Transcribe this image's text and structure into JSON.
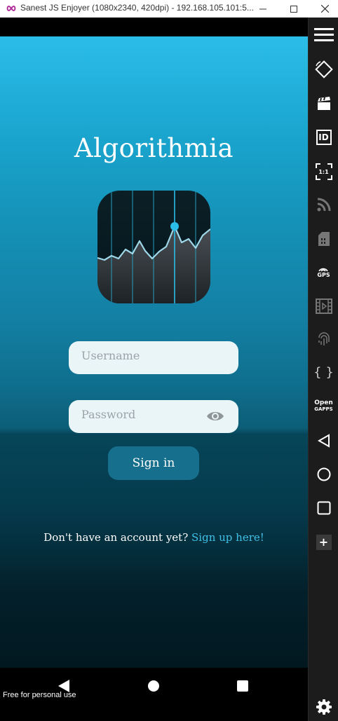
{
  "window": {
    "title": "Sanest JS Enjoyer (1080x2340, 420dpi) - 192.168.105.101:5...",
    "minimize_glyph": "—",
    "maximize_glyph": "☐",
    "close_glyph": "✕"
  },
  "app": {
    "title": "Algorithmia",
    "username_placeholder": "Username",
    "password_placeholder": "Password",
    "sign_in_label": "Sign in",
    "signup_prompt": "Don't have an account yet? ",
    "signup_link": "Sign up here!"
  },
  "navbar": {
    "watermark": "Free for personal use"
  },
  "sidebar": {
    "items": [
      {
        "icon": "menu-icon"
      },
      {
        "icon": "rotate-icon"
      },
      {
        "icon": "clapperboard-icon"
      },
      {
        "icon": "id-icon",
        "label": "ID"
      },
      {
        "icon": "pixel-perfect-icon",
        "label": "1:1"
      },
      {
        "icon": "wifi-icon"
      },
      {
        "icon": "sd-card-icon"
      },
      {
        "icon": "gps-icon",
        "label": "GPS"
      },
      {
        "icon": "film-icon"
      },
      {
        "icon": "fingerprint-icon"
      },
      {
        "icon": "braces-icon",
        "label": "{ }"
      },
      {
        "icon": "open-gapps-icon",
        "label": "Open",
        "label2": "GAPPS"
      },
      {
        "icon": "back-icon"
      },
      {
        "icon": "home-icon"
      },
      {
        "icon": "recents-icon"
      },
      {
        "icon": "add-icon",
        "label": "+"
      },
      {
        "icon": "settings-icon"
      }
    ]
  },
  "colors": {
    "screen_top": "#2bbde8",
    "screen_bottom": "#021820",
    "accent_link": "#3fc0e6",
    "sign_in_button": "#166f8c",
    "input_bg": "#eaf5f7"
  }
}
